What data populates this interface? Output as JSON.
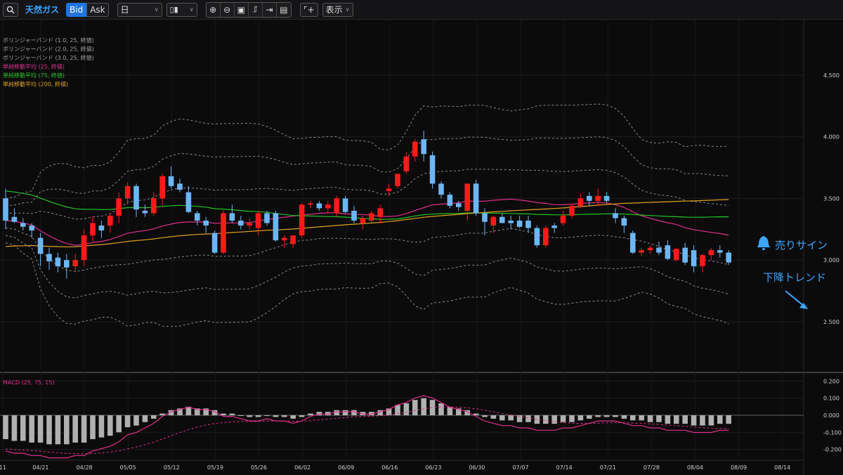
{
  "toolbar": {
    "instrument": "天然ガス",
    "bid_label": "Bid",
    "ask_label": "Ask",
    "timeframe": "日",
    "display_label": "表示"
  },
  "legend": [
    {
      "label": "ボリンジャーバンド (1.0, 25, 終値)",
      "color": "#a0a0a0"
    },
    {
      "label": "ボリンジャーバンド (2.0, 25, 終値)",
      "color": "#a0a0a0"
    },
    {
      "label": "ボリンジャーバンド (3.0, 25, 終値)",
      "color": "#a0a0a0"
    },
    {
      "label": "単純移動平均 (25, 終値)",
      "color": "#e0308a"
    },
    {
      "label": "単純移動平均 (75, 終値)",
      "color": "#22c322"
    },
    {
      "label": "単純移動平均 (200, 終値)",
      "color": "#e0a020"
    }
  ],
  "annotations": {
    "sell_signal": "売りサイン",
    "downtrend": "下降トレンド"
  },
  "colors": {
    "up": "#ff1a1a",
    "down": "#6cb6f5",
    "accent": "#3ea6ff",
    "macd": "#e0308a",
    "hist": "#b0b0b0"
  },
  "chart_data": [
    {
      "type": "candlestick",
      "y_ticks": [
        "4.500",
        "4.000",
        "3.500",
        "3.000",
        "2.500"
      ],
      "ylim": [
        2.1,
        4.95
      ],
      "x_labels": [
        "11",
        "04/21",
        "04/28",
        "05/05",
        "05/12",
        "05/19",
        "05/26",
        "06/02",
        "06/09",
        "06/16",
        "06/23",
        "06/30",
        "07/07",
        "07/14",
        "07/21",
        "07/28",
        "08/04",
        "08/09",
        "08/14"
      ],
      "candles": [
        [
          3.5,
          3.58,
          3.25,
          3.32
        ],
        [
          3.35,
          3.42,
          3.3,
          3.31
        ],
        [
          3.3,
          3.34,
          3.24,
          3.27
        ],
        [
          3.28,
          3.3,
          3.18,
          3.24
        ],
        [
          3.18,
          3.22,
          2.95,
          3.05
        ],
        [
          3.05,
          3.1,
          2.92,
          2.99
        ],
        [
          3.02,
          3.06,
          2.9,
          2.95
        ],
        [
          3.0,
          3.05,
          2.85,
          2.94
        ],
        [
          2.95,
          3.05,
          2.9,
          3.0
        ],
        [
          3.0,
          3.25,
          2.95,
          3.2
        ],
        [
          3.2,
          3.35,
          3.15,
          3.3
        ],
        [
          3.28,
          3.32,
          3.18,
          3.24
        ],
        [
          3.28,
          3.38,
          3.22,
          3.36
        ],
        [
          3.36,
          3.55,
          3.3,
          3.5
        ],
        [
          3.5,
          3.63,
          3.45,
          3.6
        ],
        [
          3.6,
          3.62,
          3.35,
          3.41
        ],
        [
          3.4,
          3.45,
          3.35,
          3.38
        ],
        [
          3.38,
          3.55,
          3.36,
          3.5
        ],
        [
          3.5,
          3.7,
          3.45,
          3.68
        ],
        [
          3.68,
          3.76,
          3.58,
          3.6
        ],
        [
          3.62,
          3.66,
          3.55,
          3.57
        ],
        [
          3.55,
          3.6,
          3.38,
          3.39
        ],
        [
          3.38,
          3.4,
          3.28,
          3.32
        ],
        [
          3.32,
          3.35,
          3.22,
          3.28
        ],
        [
          3.22,
          3.24,
          3.05,
          3.06
        ],
        [
          3.06,
          3.4,
          3.05,
          3.38
        ],
        [
          3.38,
          3.45,
          3.3,
          3.32
        ],
        [
          3.32,
          3.36,
          3.25,
          3.28
        ],
        [
          3.28,
          3.34,
          3.25,
          3.3
        ],
        [
          3.26,
          3.4,
          3.2,
          3.38
        ],
        [
          3.38,
          3.4,
          3.28,
          3.3
        ],
        [
          3.38,
          3.4,
          3.15,
          3.16
        ],
        [
          3.16,
          3.2,
          3.1,
          3.18
        ],
        [
          3.13,
          3.2,
          3.1,
          3.2
        ],
        [
          3.2,
          3.46,
          3.18,
          3.45
        ],
        [
          3.45,
          3.48,
          3.42,
          3.46
        ],
        [
          3.46,
          3.48,
          3.4,
          3.42
        ],
        [
          3.42,
          3.48,
          3.38,
          3.45
        ],
        [
          3.38,
          3.52,
          3.35,
          3.5
        ],
        [
          3.5,
          3.52,
          3.38,
          3.39
        ],
        [
          3.4,
          3.44,
          3.3,
          3.32
        ],
        [
          3.3,
          3.36,
          3.25,
          3.34
        ],
        [
          3.32,
          3.4,
          3.3,
          3.38
        ],
        [
          3.35,
          3.45,
          3.3,
          3.42
        ],
        [
          3.56,
          3.62,
          3.52,
          3.58
        ],
        [
          3.6,
          3.7,
          3.58,
          3.7
        ],
        [
          3.72,
          3.88,
          3.7,
          3.84
        ],
        [
          3.84,
          3.98,
          3.8,
          3.96
        ],
        [
          3.98,
          4.05,
          3.8,
          3.86
        ],
        [
          3.85,
          3.88,
          3.58,
          3.62
        ],
        [
          3.62,
          3.64,
          3.5,
          3.53
        ],
        [
          3.53,
          3.55,
          3.42,
          3.44
        ],
        [
          3.46,
          3.48,
          3.4,
          3.43
        ],
        [
          3.4,
          3.5,
          3.32,
          3.62
        ],
        [
          3.62,
          3.65,
          3.36,
          3.38
        ],
        [
          3.38,
          3.42,
          3.2,
          3.31
        ],
        [
          3.28,
          3.36,
          3.22,
          3.35
        ],
        [
          3.35,
          3.38,
          3.3,
          3.3
        ],
        [
          3.32,
          3.36,
          3.25,
          3.3
        ],
        [
          3.32,
          3.36,
          3.26,
          3.27
        ],
        [
          3.32,
          3.36,
          3.22,
          3.26
        ],
        [
          3.26,
          3.28,
          3.1,
          3.12
        ],
        [
          3.12,
          3.28,
          3.1,
          3.26
        ],
        [
          3.28,
          3.3,
          3.22,
          3.26
        ],
        [
          3.3,
          3.4,
          3.28,
          3.36
        ],
        [
          3.36,
          3.46,
          3.34,
          3.44
        ],
        [
          3.44,
          3.54,
          3.42,
          3.5
        ],
        [
          3.52,
          3.55,
          3.44,
          3.48
        ],
        [
          3.48,
          3.58,
          3.44,
          3.52
        ],
        [
          3.52,
          3.55,
          3.46,
          3.48
        ],
        [
          3.38,
          3.42,
          3.3,
          3.34
        ],
        [
          3.34,
          3.36,
          3.22,
          3.28
        ],
        [
          3.22,
          3.24,
          3.05,
          3.06
        ],
        [
          3.06,
          3.1,
          3.03,
          3.08
        ],
        [
          3.08,
          3.12,
          3.05,
          3.1
        ],
        [
          3.1,
          3.15,
          3.04,
          3.06
        ],
        [
          3.12,
          3.16,
          3.0,
          3.01
        ],
        [
          3.0,
          3.1,
          2.99,
          3.09
        ],
        [
          3.1,
          3.14,
          2.96,
          2.98
        ],
        [
          3.08,
          3.12,
          2.9,
          2.95
        ],
        [
          2.95,
          3.05,
          2.9,
          3.04
        ],
        [
          3.04,
          3.1,
          3.0,
          3.08
        ],
        [
          3.08,
          3.12,
          3.02,
          3.06
        ],
        [
          3.06,
          3.08,
          2.96,
          2.98
        ]
      ],
      "bollinger_sigma": [
        1,
        2,
        3
      ],
      "moving_averages": [
        25,
        75,
        200
      ]
    },
    {
      "type": "macd",
      "title": "MACD (25, 75, 15)",
      "y_ticks": [
        "0.200",
        "0.100",
        "0.000",
        "-0.100",
        "-0.200"
      ],
      "ylim": [
        -0.21,
        0.21
      ],
      "histogram": [
        -0.14,
        -0.15,
        -0.15,
        -0.16,
        -0.16,
        -0.17,
        -0.17,
        -0.17,
        -0.16,
        -0.16,
        -0.14,
        -0.13,
        -0.12,
        -0.1,
        -0.07,
        -0.06,
        -0.04,
        -0.02,
        0.01,
        0.03,
        0.04,
        0.05,
        0.04,
        0.04,
        0.03,
        0.01,
        0.01,
        0.0,
        -0.01,
        -0.01,
        0.0,
        -0.01,
        -0.01,
        -0.02,
        -0.01,
        0.01,
        0.02,
        0.02,
        0.03,
        0.03,
        0.03,
        0.02,
        0.02,
        0.03,
        0.04,
        0.06,
        0.07,
        0.09,
        0.1,
        0.09,
        0.07,
        0.05,
        0.04,
        0.03,
        0.01,
        -0.01,
        -0.02,
        -0.03,
        -0.03,
        -0.04,
        -0.04,
        -0.05,
        -0.05,
        -0.05,
        -0.04,
        -0.04,
        -0.03,
        -0.02,
        -0.01,
        -0.01,
        -0.01,
        -0.02,
        -0.03,
        -0.03,
        -0.04,
        -0.04,
        -0.05,
        -0.05,
        -0.05,
        -0.06,
        -0.06,
        -0.06,
        -0.05,
        -0.05
      ]
    }
  ]
}
